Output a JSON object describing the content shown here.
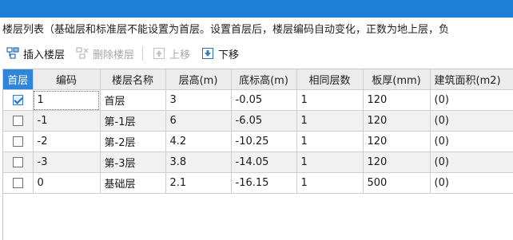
{
  "description": "楼层列表（基础层和标准层不能设置为首层。设置首层后，楼层编码自动变化，正数为地上层，负",
  "toolbar": {
    "insert_label": "插入楼层",
    "delete_label": "删除楼层",
    "up_label": "上移",
    "down_label": "下移"
  },
  "table": {
    "headers": [
      "首层",
      "编码",
      "楼层名称",
      "层高(m)",
      "底标高(m)",
      "相同层数",
      "板厚(mm)",
      "建筑面积(m2)"
    ],
    "rows": [
      {
        "first": true,
        "code": "1",
        "name": "首层",
        "height": "3",
        "bottom": "-0.05",
        "same": "1",
        "thick": "120",
        "area": "(0)"
      },
      {
        "first": false,
        "code": "-1",
        "name": "第-1层",
        "height": "6",
        "bottom": "-6.05",
        "same": "1",
        "thick": "120",
        "area": "(0)"
      },
      {
        "first": false,
        "code": "-2",
        "name": "第-2层",
        "height": "4.2",
        "bottom": "-10.25",
        "same": "1",
        "thick": "120",
        "area": "(0)"
      },
      {
        "first": false,
        "code": "-3",
        "name": "第-3层",
        "height": "3.8",
        "bottom": "-14.05",
        "same": "1",
        "thick": "120",
        "area": "(0)"
      },
      {
        "first": false,
        "code": "0",
        "name": "基础层",
        "height": "2.1",
        "bottom": "-16.15",
        "same": "1",
        "thick": "500",
        "area": "(0)"
      }
    ]
  },
  "colors": {
    "accent": "#2f86d8",
    "title_bar": "#1e7fd6"
  },
  "icons": [
    "insert-floor-icon",
    "delete-floor-icon",
    "move-up-icon",
    "move-down-icon",
    "checkbox-icon"
  ]
}
